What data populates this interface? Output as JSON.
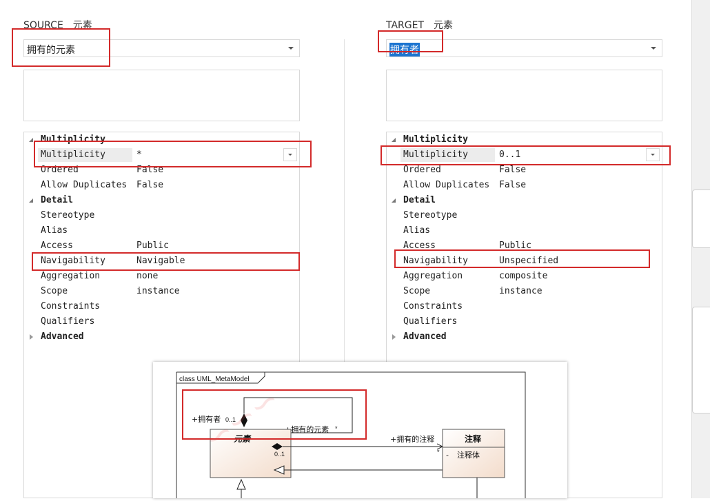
{
  "source": {
    "header": "SOURCE　元素",
    "role": "拥有的元素",
    "multiplicity_value": "*",
    "rows": [
      {
        "type": "category",
        "label": "Multiplicity",
        "expanded": true
      },
      {
        "type": "prop",
        "label": "Multiplicity",
        "value": "*",
        "selected": true
      },
      {
        "type": "prop",
        "label": "Ordered",
        "value": "False"
      },
      {
        "type": "prop",
        "label": "Allow Duplicates",
        "value": "False"
      },
      {
        "type": "category",
        "label": "Detail",
        "expanded": true
      },
      {
        "type": "prop",
        "label": "Stereotype",
        "value": ""
      },
      {
        "type": "prop",
        "label": "Alias",
        "value": ""
      },
      {
        "type": "prop",
        "label": "Access",
        "value": "Public"
      },
      {
        "type": "prop",
        "label": "Navigability",
        "value": "Navigable"
      },
      {
        "type": "prop",
        "label": "Aggregation",
        "value": "none"
      },
      {
        "type": "prop",
        "label": "Scope",
        "value": "instance"
      },
      {
        "type": "prop",
        "label": "Constraints",
        "value": ""
      },
      {
        "type": "prop",
        "label": "Qualifiers",
        "value": ""
      },
      {
        "type": "category",
        "label": "Advanced",
        "expanded": false
      }
    ]
  },
  "target": {
    "header": "TARGET　元素",
    "role": "拥有者",
    "rows": [
      {
        "type": "category",
        "label": "Multiplicity",
        "expanded": true
      },
      {
        "type": "prop",
        "label": "Multiplicity",
        "value": "0..1",
        "selected": true
      },
      {
        "type": "prop",
        "label": "Ordered",
        "value": "False"
      },
      {
        "type": "prop",
        "label": "Allow Duplicates",
        "value": "False"
      },
      {
        "type": "category",
        "label": "Detail",
        "expanded": true
      },
      {
        "type": "prop",
        "label": "Stereotype",
        "value": ""
      },
      {
        "type": "prop",
        "label": "Alias",
        "value": ""
      },
      {
        "type": "prop",
        "label": "Access",
        "value": "Public"
      },
      {
        "type": "prop",
        "label": "Navigability",
        "value": "Unspecified"
      },
      {
        "type": "prop",
        "label": "Aggregation",
        "value": "composite"
      },
      {
        "type": "prop",
        "label": "Scope",
        "value": "instance"
      },
      {
        "type": "prop",
        "label": "Constraints",
        "value": ""
      },
      {
        "type": "prop",
        "label": "Qualifiers",
        "value": ""
      },
      {
        "type": "category",
        "label": "Advanced",
        "expanded": false
      }
    ]
  },
  "diagram": {
    "frame_label": "class UML_MetaModel",
    "element_class": "元素",
    "note_class": "注释",
    "note_attr": "注释体",
    "note_attr_visibility": "-",
    "owner_label": "+拥有者",
    "owner_mult": "0..1",
    "owned_label": "+拥有的元素",
    "owned_mult": "*",
    "assoc_label": "+拥有的注释",
    "assoc_src_mult": "0..1",
    "assoc_dst_mult": "*"
  },
  "colors": {
    "highlight_red": "#d32a2a",
    "selection_blue": "#1c74d0",
    "class_fill": "#f6e6da"
  }
}
